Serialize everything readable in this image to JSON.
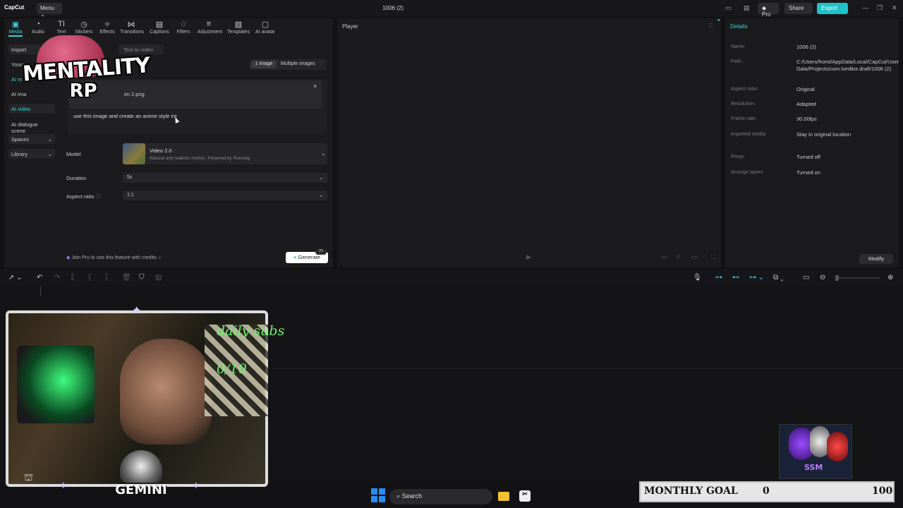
{
  "app": {
    "name": "CapCut",
    "menu_label": "Menu ⌄",
    "project_title": "1006 (2)"
  },
  "titlebar": {
    "pro_label": "◆ Pro",
    "share_label": "Share",
    "export_label": "Export"
  },
  "toolbar": {
    "items": [
      {
        "label": "Media",
        "icon": "media-icon",
        "glyph": "▣"
      },
      {
        "label": "Audio",
        "icon": "audio-icon",
        "glyph": "◔"
      },
      {
        "label": "Text",
        "icon": "text-icon",
        "glyph": "TI"
      },
      {
        "label": "Stickers",
        "icon": "stickers-icon",
        "glyph": "◷"
      },
      {
        "label": "Effects",
        "icon": "effects-icon",
        "glyph": "✧"
      },
      {
        "label": "Transitions",
        "icon": "transitions-icon",
        "glyph": "⋈"
      },
      {
        "label": "Captions",
        "icon": "captions-icon",
        "glyph": "▤"
      },
      {
        "label": "Filters",
        "icon": "filters-icon",
        "glyph": "♢"
      },
      {
        "label": "Adjustment",
        "icon": "adjustment-icon",
        "glyph": "≡"
      },
      {
        "label": "Templates",
        "icon": "templates-icon",
        "glyph": "▧"
      },
      {
        "label": "AI avatar",
        "icon": "ai-avatar-icon",
        "glyph": "▢"
      }
    ]
  },
  "sidebar": {
    "items": [
      {
        "label": "Import"
      },
      {
        "label": "Yours"
      },
      {
        "label": "AI m"
      },
      {
        "label": "AI ima"
      },
      {
        "label": "AI video"
      },
      {
        "label": "AI dialogue scene"
      },
      {
        "label": "Spaces"
      },
      {
        "label": "Library"
      }
    ]
  },
  "media_panel": {
    "tab_text_to_video": "Text to video",
    "image_toggle": [
      "1 image",
      "Multiple images"
    ],
    "file_name": "im 2.png",
    "prompt": "use this image and create an anime style int",
    "model_label": "Model",
    "model_name": "Video 2.0",
    "model_desc": "Natural and realistic motion. Powered by Runway.",
    "duration_label": "Duration",
    "duration_value": "5s",
    "aspect_label": "Aspect ratio",
    "aspect_value": "1:1",
    "join_pro": "Join Pro to use this feature with credits.",
    "generate_label": "Generate",
    "credits": "25"
  },
  "player": {
    "title": "Player"
  },
  "details": {
    "title": "Details",
    "rows": [
      {
        "k": "Name:",
        "v": "1006 (2)"
      },
      {
        "k": "Path:",
        "v": "C:/Users/fromt/AppData/Local/CapCut/User Data/Projects/com.lveditor.draft/1006 (2)"
      },
      {
        "k": "Aspect ratio:",
        "v": "Original"
      },
      {
        "k": "Resolution:",
        "v": "Adapted"
      },
      {
        "k": "Frame rate:",
        "v": "30.00fps"
      },
      {
        "k": "Imported media:",
        "v": "Stay in original location"
      },
      {
        "k": "Proxy:",
        "v": "Turned off"
      },
      {
        "k": "Arrange layers",
        "v": "Turned on"
      }
    ],
    "modify_label": "Modify"
  },
  "overlay": {
    "brand_line1": "MENTALITY",
    "brand_line2": "RP",
    "daily_subs": "daily subs",
    "subs_count": "0/10",
    "gemini": "GEMINI",
    "ssm": "SSM",
    "goal_label": "MONTHLY GOAL",
    "goal_current": "0",
    "goal_target": "100"
  },
  "taskbar": {
    "search_label": "Search"
  }
}
